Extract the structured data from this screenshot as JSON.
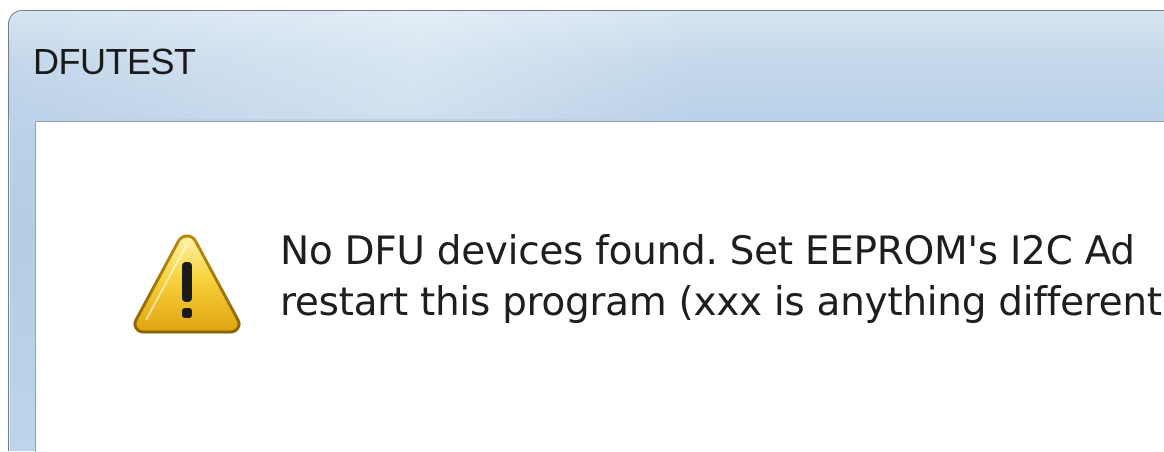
{
  "window": {
    "title": "DFUTEST"
  },
  "dialog": {
    "icon": "warning-icon",
    "message_lines": [
      "No DFU devices found. Set EEPROM's I2C Ad",
      "restart this program (xxx is anything different"
    ]
  },
  "colors": {
    "titlebar": "#c4d8eb",
    "border": "#6f7f90",
    "warning_fill": "#f5c518"
  }
}
